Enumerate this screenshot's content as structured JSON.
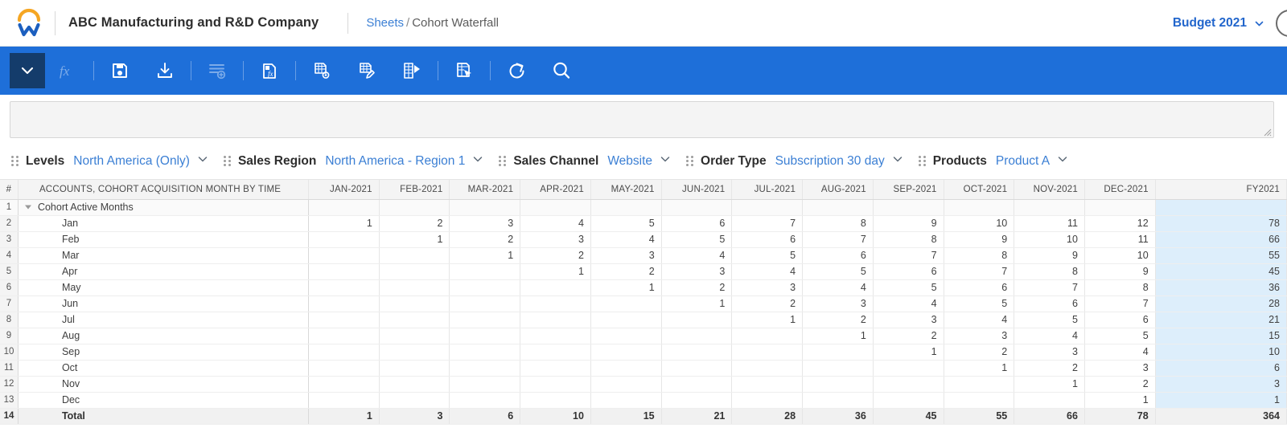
{
  "header": {
    "logo_icon": "workday-logo",
    "company_name": "ABC Manufacturing and R&D Company",
    "breadcrumb": {
      "root": "Sheets",
      "separator": "/",
      "current": "Cohort Waterfall"
    },
    "budget_selector": "Budget 2021",
    "chevron_icon": "chevron-down-icon",
    "avatar_icon": "user-avatar"
  },
  "toolbar": {
    "background": "#1e6fd9",
    "active_background": "#143c6b",
    "buttons": [
      {
        "name": "view-dropdown",
        "icon": "chevron-down-icon",
        "active": true,
        "disabled": false
      },
      {
        "name": "formula",
        "icon": "fx-icon",
        "active": false,
        "disabled": true
      },
      {
        "name": "save",
        "icon": "save-disk-icon",
        "active": false,
        "disabled": false
      },
      {
        "name": "download",
        "icon": "download-icon",
        "active": false,
        "disabled": false
      },
      {
        "name": "add-row",
        "icon": "add-row-icon",
        "active": false,
        "disabled": true
      },
      {
        "name": "paste-formula",
        "icon": "paste-fx-icon",
        "active": false,
        "disabled": false
      },
      {
        "name": "sheet-settings",
        "icon": "sheet-gear-icon",
        "active": false,
        "disabled": false
      },
      {
        "name": "sheet-edit",
        "icon": "sheet-pencil-icon",
        "active": false,
        "disabled": false
      },
      {
        "name": "sheet-play",
        "icon": "sheet-play-icon",
        "active": false,
        "disabled": false
      },
      {
        "name": "sheet-select",
        "icon": "sheet-cursor-icon",
        "active": false,
        "disabled": false
      },
      {
        "name": "refresh",
        "icon": "refresh-icon",
        "active": false,
        "disabled": false
      },
      {
        "name": "search",
        "icon": "search-icon",
        "active": false,
        "disabled": false
      }
    ]
  },
  "formula_bar": {
    "value": "",
    "placeholder": ""
  },
  "filters": [
    {
      "label": "Levels",
      "value": "North America (Only)",
      "chevron": "chevron-down-icon",
      "handle": "drag-handle-icon"
    },
    {
      "label": "Sales Region",
      "value": "North America - Region 1",
      "chevron": "chevron-down-icon",
      "handle": "drag-handle-icon"
    },
    {
      "label": "Sales Channel",
      "value": "Website",
      "chevron": "chevron-down-icon",
      "handle": "drag-handle-icon"
    },
    {
      "label": "Order Type",
      "value": "Subscription 30 day",
      "chevron": "chevron-down-icon",
      "handle": "drag-handle-icon"
    },
    {
      "label": "Products",
      "value": "Product A",
      "chevron": "chevron-down-icon",
      "handle": "drag-handle-icon"
    }
  ],
  "grid": {
    "accent_fy_color": "#ddeefb",
    "row_number_header": "#",
    "account_header": "ACCOUNTS, COHORT ACQUISITION MONTH BY TIME",
    "columns": [
      "JAN-2021",
      "FEB-2021",
      "MAR-2021",
      "APR-2021",
      "MAY-2021",
      "JUN-2021",
      "JUL-2021",
      "AUG-2021",
      "SEP-2021",
      "OCT-2021",
      "NOV-2021",
      "DEC-2021"
    ],
    "total_column": "FY2021",
    "rows": [
      {
        "n": "1",
        "label": "Cohort Active Months",
        "kind": "group",
        "values": [
          "",
          "",
          "",
          "",
          "",
          "",
          "",
          "",
          "",
          "",
          "",
          ""
        ],
        "fy": ""
      },
      {
        "n": "2",
        "label": "Jan",
        "kind": "child",
        "values": [
          "1",
          "2",
          "3",
          "4",
          "5",
          "6",
          "7",
          "8",
          "9",
          "10",
          "11",
          "12"
        ],
        "fy": "78"
      },
      {
        "n": "3",
        "label": "Feb",
        "kind": "child",
        "values": [
          "",
          "1",
          "2",
          "3",
          "4",
          "5",
          "6",
          "7",
          "8",
          "9",
          "10",
          "11"
        ],
        "fy": "66"
      },
      {
        "n": "4",
        "label": "Mar",
        "kind": "child",
        "values": [
          "",
          "",
          "1",
          "2",
          "3",
          "4",
          "5",
          "6",
          "7",
          "8",
          "9",
          "10"
        ],
        "fy": "55"
      },
      {
        "n": "5",
        "label": "Apr",
        "kind": "child",
        "values": [
          "",
          "",
          "",
          "1",
          "2",
          "3",
          "4",
          "5",
          "6",
          "7",
          "8",
          "9"
        ],
        "fy": "45"
      },
      {
        "n": "6",
        "label": "May",
        "kind": "child",
        "values": [
          "",
          "",
          "",
          "",
          "1",
          "2",
          "3",
          "4",
          "5",
          "6",
          "7",
          "8"
        ],
        "fy": "36"
      },
      {
        "n": "7",
        "label": "Jun",
        "kind": "child",
        "values": [
          "",
          "",
          "",
          "",
          "",
          "1",
          "2",
          "3",
          "4",
          "5",
          "6",
          "7"
        ],
        "fy": "28"
      },
      {
        "n": "8",
        "label": "Jul",
        "kind": "child",
        "values": [
          "",
          "",
          "",
          "",
          "",
          "",
          "1",
          "2",
          "3",
          "4",
          "5",
          "6"
        ],
        "fy": "21"
      },
      {
        "n": "9",
        "label": "Aug",
        "kind": "child",
        "values": [
          "",
          "",
          "",
          "",
          "",
          "",
          "",
          "1",
          "2",
          "3",
          "4",
          "5"
        ],
        "fy": "15"
      },
      {
        "n": "10",
        "label": "Sep",
        "kind": "child",
        "values": [
          "",
          "",
          "",
          "",
          "",
          "",
          "",
          "",
          "1",
          "2",
          "3",
          "4"
        ],
        "fy": "10"
      },
      {
        "n": "11",
        "label": "Oct",
        "kind": "child",
        "values": [
          "",
          "",
          "",
          "",
          "",
          "",
          "",
          "",
          "",
          "1",
          "2",
          "3"
        ],
        "fy": "6"
      },
      {
        "n": "12",
        "label": "Nov",
        "kind": "child",
        "values": [
          "",
          "",
          "",
          "",
          "",
          "",
          "",
          "",
          "",
          "",
          "1",
          "2"
        ],
        "fy": "3"
      },
      {
        "n": "13",
        "label": "Dec",
        "kind": "child",
        "values": [
          "",
          "",
          "",
          "",
          "",
          "",
          "",
          "",
          "",
          "",
          "",
          "1"
        ],
        "fy": "1"
      },
      {
        "n": "14",
        "label": "Total",
        "kind": "total",
        "values": [
          "1",
          "3",
          "6",
          "10",
          "15",
          "21",
          "28",
          "36",
          "45",
          "55",
          "66",
          "78"
        ],
        "fy": "364"
      }
    ]
  }
}
